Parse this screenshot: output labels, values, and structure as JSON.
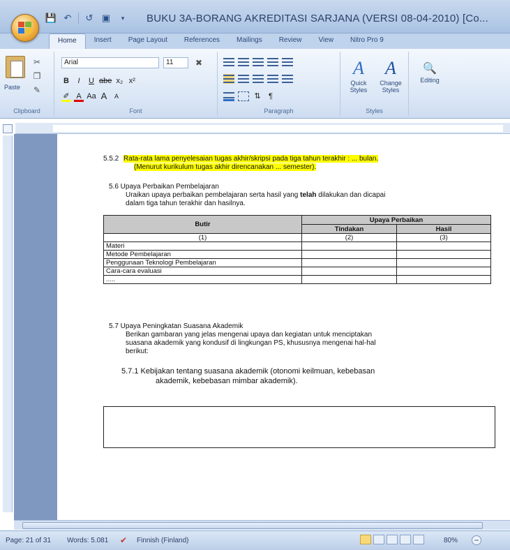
{
  "window": {
    "title": "BUKU 3A-BORANG AKREDITASI SARJANA (VERSI 08-04-2010) [Co..."
  },
  "ribbon_tabs": [
    "Home",
    "Insert",
    "Page Layout",
    "References",
    "Mailings",
    "Review",
    "View",
    "Nitro Pro 9"
  ],
  "ribbon": {
    "clipboard": {
      "paste": "Paste",
      "label": "Clipboard"
    },
    "font": {
      "name": "Arial",
      "size": "11",
      "label": "Font",
      "bold": "B",
      "italic": "I",
      "underline": "U",
      "strike": "abe",
      "subscript": "x₂",
      "superscript": "x²",
      "grow": "A",
      "shrink": "A",
      "case": "Aa"
    },
    "paragraph": {
      "label": "Paragraph"
    },
    "styles": {
      "quick": "Quick Styles",
      "change": "Change Styles",
      "label": "Styles"
    },
    "editing": {
      "label": "Editing"
    }
  },
  "document": {
    "s552_num": "5.5.2",
    "s552_line1": "Rata-rata lama penyelesaian tugas akhir/skripsi pada tiga tahun terakhir : ... bulan.",
    "s552_line2": "(Menurut kurikulum tugas akhir direncanakan ... semester).",
    "s56_heading": "5.6  Upaya Perbaikan Pembelajaran",
    "s56_line1a": "Uraikan upaya perbaikan pembelajaran serta hasil yang ",
    "s56_line1b": "telah",
    "s56_line1c": " dilakukan dan dicapai",
    "s56_line2": "dalam tiga tahun terakhir dan hasilnya.",
    "table": {
      "col_butir": "Butir",
      "col_upaya": "Upaya Perbaikan",
      "col_tindakan": "Tindakan",
      "col_hasil": "Hasil",
      "num": [
        "(1)",
        "(2)",
        "(3)"
      ],
      "rows": [
        "Materi",
        "Metode Pembelajaran",
        "Penggunaan Teknologi Pembelajaran",
        "Cara-cara evaluasi",
        "....."
      ]
    },
    "s57_heading": "5.7  Upaya Peningkatan Suasana Akademik",
    "s57_line1": "Berikan gambaran yang jelas mengenai upaya dan kegiatan untuk menciptakan",
    "s57_line2": "suasana akademik yang kondusif di lingkungan PS, khususnya mengenai hal-hal",
    "s57_line3": "berikut:",
    "s571_line1": "5.7.1   Kebijakan tentang suasana akademik (otonomi keilmuan, kebebasan",
    "s571_line2": "akademik, kebebasan mimbar akademik)."
  },
  "status": {
    "page": "Page: 21 of 31",
    "words": "Words: 5.081",
    "language": "Finnish (Finland)",
    "zoom": "80%"
  }
}
